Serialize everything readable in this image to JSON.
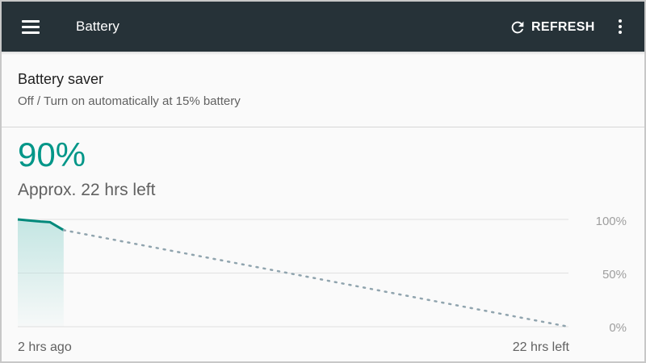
{
  "toolbar": {
    "menu_icon": "hamburger-menu-icon",
    "title": "Battery",
    "refresh_icon": "refresh-icon",
    "refresh_label": "REFRESH",
    "overflow_icon": "more-vert-icon",
    "background": "#263238"
  },
  "battery_saver": {
    "title": "Battery saver",
    "summary": "Off / Turn on automatically at 15% battery"
  },
  "status": {
    "level": "90%",
    "estimate": "Approx. 22 hrs left",
    "accent": "#009688"
  },
  "chart_data": {
    "type": "line",
    "y_ticks": [
      "100%",
      "50%",
      "0%"
    ],
    "ylim": [
      0,
      100
    ],
    "x_labels": {
      "left": "2 hrs ago",
      "right": "22 hrs left"
    },
    "history": {
      "x_hours": [
        -2,
        -1.5,
        -1.0,
        -0.6,
        0
      ],
      "y": [
        100,
        99,
        98,
        97.5,
        90
      ]
    },
    "projection": {
      "x_hours": [
        0,
        22
      ],
      "y": [
        90,
        0
      ]
    },
    "xlim": [
      -2,
      22
    ],
    "colors": {
      "history": "#00897b",
      "fill": "#b2dfdb",
      "projection": "#90a4ae",
      "grid": "#e0e0e0"
    }
  }
}
